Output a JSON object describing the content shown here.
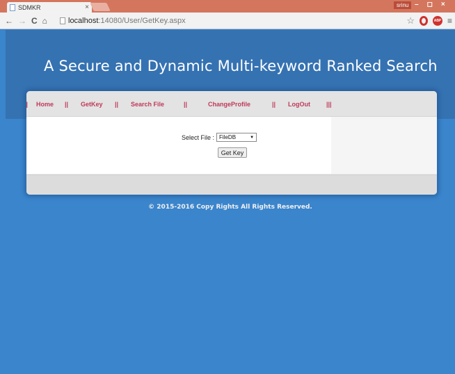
{
  "browser": {
    "tab_title": "SDMKR",
    "tab_close": "×",
    "user_badge": "srinu",
    "window_buttons": [
      "–",
      "◻",
      "×"
    ],
    "url_host": "localhost",
    "url_rest": ":14080/User/GetKey.aspx",
    "nav_back": "←",
    "nav_forward": "→",
    "nav_reload": "C",
    "nav_home": "⌂",
    "star": "☆",
    "menu": "≡",
    "abp_label": "ABP"
  },
  "page": {
    "site_title": "A Secure and Dynamic Multi-keyword Ranked Search",
    "nav": {
      "sep0": "||",
      "home": "Home",
      "sep1": "||",
      "getkey": "GetKey",
      "sep2": "||",
      "search_file": "Search File",
      "sep3": "||",
      "change_profile": "ChangeProfile",
      "sep4": "||",
      "logout": "LogOut",
      "sep5": "|||"
    },
    "form": {
      "select_label": "Select File :",
      "select_value": "FileDB",
      "select_arrow": "▼",
      "button_label": "Get Key"
    },
    "copyright": "© 2015-2016 Copy Rights All Rights Reserved."
  }
}
